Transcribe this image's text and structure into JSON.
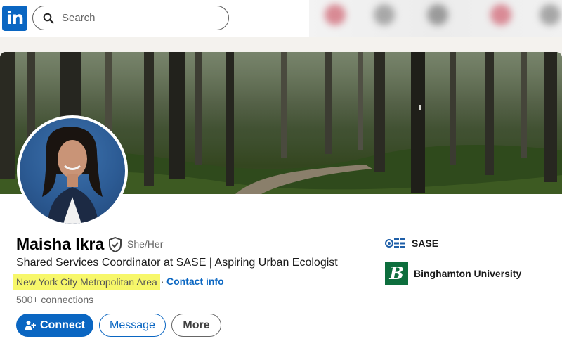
{
  "nav": {
    "logo_text": "in",
    "search_placeholder": "Search"
  },
  "profile": {
    "name": "Maisha Ikra",
    "pronouns": "She/Her",
    "headline": "Shared Services Coordinator at SASE | Aspiring Urban Ecologist",
    "location": "New York City Metropolitan Area",
    "separator": "·",
    "contact_info_label": "Contact info",
    "connections": "500+ connections"
  },
  "actions": {
    "connect_label": "Connect",
    "message_label": "Message",
    "more_label": "More"
  },
  "experience": [
    {
      "name": "SASE",
      "icon": "sase-logo-icon"
    },
    {
      "name": "Binghamton University",
      "icon": "binghamton-logo-icon",
      "logo_text": "B"
    }
  ],
  "colors": {
    "brand": "#0a66c2",
    "highlight": "#f7f76a",
    "binghamton_green": "#0d6e3d"
  }
}
